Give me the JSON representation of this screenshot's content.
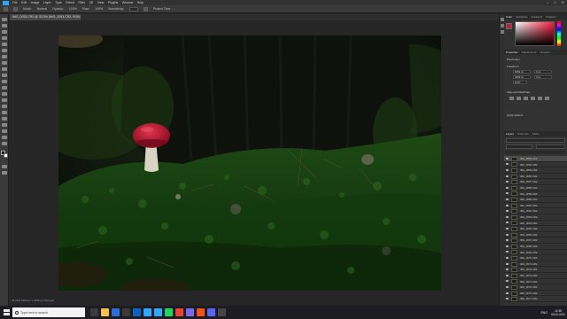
{
  "menubar": {
    "items": [
      "File",
      "Edit",
      "Image",
      "Layer",
      "Type",
      "Select",
      "Filter",
      "3D",
      "View",
      "Plugins",
      "Window",
      "Help"
    ]
  },
  "optionsbar": {
    "mode_label": "Mode:",
    "mode_value": "Normal",
    "opacity_label": "Opacity:",
    "opacity_value": "100%",
    "flow_label": "Flow:",
    "flow_value": "100%",
    "smoothing_label": "Smoothing:",
    "protect_tone": "Protect Tone"
  },
  "document": {
    "tab_title": "IMG_0053.CR2 @ 33.3% (IMG_0053.CR2, RGB/16*)",
    "status": "33.33%    5184 px x 3456 px (300 ppi)"
  },
  "panels": {
    "color_tabs": [
      "Color",
      "Swatches",
      "Gradients",
      "Patterns"
    ],
    "props_tabs": [
      "Properties",
      "Adjustments",
      "Libraries"
    ],
    "layer_label": "Pixel Layer",
    "transform_title": "Transform",
    "transform_w": "5184 px",
    "transform_h": "3456 px",
    "transform_x": "0 px",
    "transform_y": "0 px",
    "transform_angle": "0.00°",
    "align_title": "Align and Distribute",
    "quick_actions": "Quick Actions",
    "layers_tabs": [
      "Layers",
      "Channels",
      "Paths"
    ],
    "layers": [
      "IMG_0053.CR2",
      "IMG_0054.CR2",
      "IMG_0055.CR2",
      "IMG_0056.CR2",
      "IMG_0057.CR2",
      "IMG_0058.CR2",
      "IMG_0059.CR2",
      "IMG_0060.CR2",
      "IMG_0061.CR2",
      "IMG_0062.CR2",
      "IMG_0063.CR2",
      "IMG_0064.CR2",
      "IMG_0065.CR2",
      "IMG_0066.CR2",
      "IMG_0067.CR2",
      "IMG_0068.CR2",
      "IMG_0069.CR2",
      "IMG_0070.CR2",
      "IMG_0071.CR2",
      "IMG_0072.CR2",
      "IMG_0073.CR2",
      "IMG_0074.CR2",
      "IMG_0075.CR2",
      "IMG_0076.CR2",
      "IMG_0077.CR2"
    ]
  },
  "taskbar": {
    "search_placeholder": "Type here to search",
    "tray_lang": "ENG",
    "time": "11:58",
    "date": "08.10.2021"
  },
  "colors": {
    "accent": "#2fa3f7",
    "foreground_swatch": "#000000",
    "background_swatch": "#ffffff",
    "picker_hue": "#ff1a3c"
  }
}
